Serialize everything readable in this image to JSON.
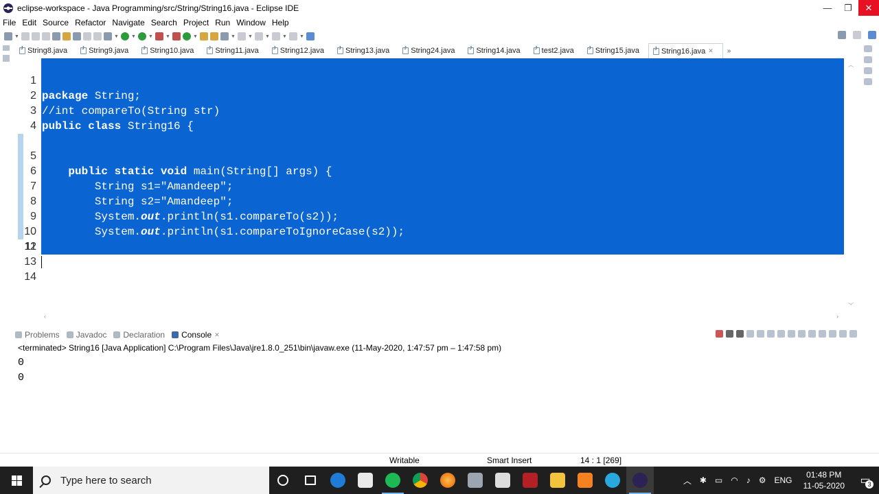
{
  "window": {
    "title": "eclipse-workspace - Java Programming/src/String/String16.java - Eclipse IDE",
    "minimize": "—",
    "restore": "❐",
    "close": "✕"
  },
  "menu": [
    "File",
    "Edit",
    "Source",
    "Refactor",
    "Navigate",
    "Search",
    "Project",
    "Run",
    "Window",
    "Help"
  ],
  "editor_tabs": [
    "String8.java",
    "String9.java",
    "String10.java",
    "String11.java",
    "String12.java",
    "String13.java",
    "String24.java",
    "String14.java",
    "test2.java",
    "String15.java",
    "String16.java"
  ],
  "active_tab": "String16.java",
  "tab_overflow": "»",
  "code": {
    "line_numbers": [
      "1",
      "2",
      "3",
      "4",
      "5",
      "6",
      "7",
      "8",
      "9",
      "10",
      "11",
      "12",
      "13",
      "14"
    ],
    "lines": [
      "package String;",
      "//int compareTo(String str)",
      "public class String16 {",
      "",
      "    public static void main(String[] args) {",
      "        String s1=\"Amandeep\";",
      "        String s2=\"Amandeep\";",
      "        System.out.println(s1.compareTo(s2));",
      "        System.out.println(s1.compareToIgnoreCase(s2));",
      "",
      "    }",
      "",
      "}",
      ""
    ]
  },
  "bottom_tabs": [
    "Problems",
    "Javadoc",
    "Declaration",
    "Console"
  ],
  "active_bottom_tab": "Console",
  "console": {
    "header": "<terminated> String16 [Java Application] C:\\Program Files\\Java\\jre1.8.0_251\\bin\\javaw.exe  (11-May-2020, 1:47:57 pm – 1:47:58 pm)",
    "output": [
      "0",
      "0"
    ]
  },
  "status": {
    "writable": "Writable",
    "insert_mode": "Smart Insert",
    "position": "14 : 1 [269]"
  },
  "taskbar": {
    "search_placeholder": "Type here to search",
    "language": "ENG",
    "time": "01:48 PM",
    "date": "11-05-2020",
    "notification_count": "3"
  },
  "colors": {
    "selection": "#0a64d2",
    "taskbar": "#1f1f1f",
    "close_button": "#e81123"
  }
}
